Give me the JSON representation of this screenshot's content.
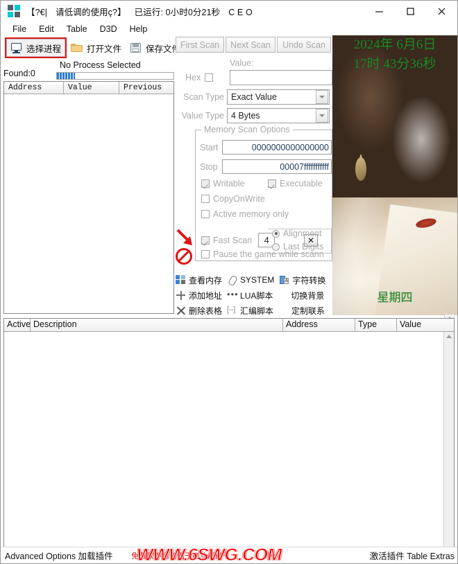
{
  "window": {
    "title_segments": [
      "【?€|",
      "请低调的使用ç?】",
      "已运行: 0小时0分21秒",
      "C E O"
    ],
    "minimize": "—",
    "maximize": "□",
    "close": "✕"
  },
  "menu": [
    "File",
    "Edit",
    "Table",
    "D3D",
    "Help"
  ],
  "toolbar": {
    "select_process": "选择进程",
    "open_file": "打开文件",
    "save_file": "保存文件"
  },
  "left": {
    "no_process": "No Process Selected",
    "found": "Found:0",
    "columns": [
      "Address",
      "Value",
      "Previous"
    ]
  },
  "scan": {
    "first_scan": "First Scan",
    "next_scan": "Next Scan",
    "undo_scan": "Undo Scan",
    "value_label": "Value:",
    "hex_label": "Hex",
    "hex_checked": false,
    "value_text": "",
    "scan_type_label": "Scan Type",
    "scan_type_value": "Exact Value",
    "value_type_label": "Value Type",
    "value_type_value": "4 Bytes",
    "options_legend": "Memory Scan Options",
    "start_label": "Start",
    "start_value": "0000000000000000",
    "stop_label": "Stop",
    "stop_value": "00007fffffffffff",
    "writable": "Writable",
    "writable_checked": true,
    "executable": "Executable",
    "executable_checked": true,
    "copyonwrite": "CopyOnWrite",
    "copyonwrite_checked": false,
    "active_memory_only": "Active memory only",
    "active_memory_checked": false,
    "close_x": "✕",
    "fast_scan": "Fast Scan",
    "fast_scan_checked": true,
    "fast_scan_value": "4",
    "alignment": "Alignment",
    "alignment_selected": true,
    "last_digits": "Last Digits",
    "last_digits_selected": false,
    "pause_game": "Pause the game while scann",
    "pause_checked": false
  },
  "tools": {
    "row1": [
      "查看内存",
      "SYSTEM",
      "字符转换"
    ],
    "row2": [
      "添加地址",
      "LUA脚本",
      "切换背景"
    ],
    "row3": [
      "删除表格",
      "汇编脚本",
      "定制联系"
    ]
  },
  "overlay": {
    "date": "2024年 6月6日",
    "time": "17时 43分36秒",
    "weekday": "星期四"
  },
  "cheat_table": {
    "columns": [
      "Active",
      "Description",
      "Address",
      "Type",
      "Value"
    ],
    "rows": []
  },
  "status": {
    "left": "Advanced Options 加载插件",
    "middle": "免费软件请勿用于商业用途",
    "right": "激活插件 Table Extras",
    "watermark": "WWW.6SWG.COM"
  },
  "colors": {
    "highlight_red": "#e01414",
    "overlay_green": "#1d8a26",
    "watermark_red": "#f20000",
    "accent_cyan": "#00c9cf"
  }
}
